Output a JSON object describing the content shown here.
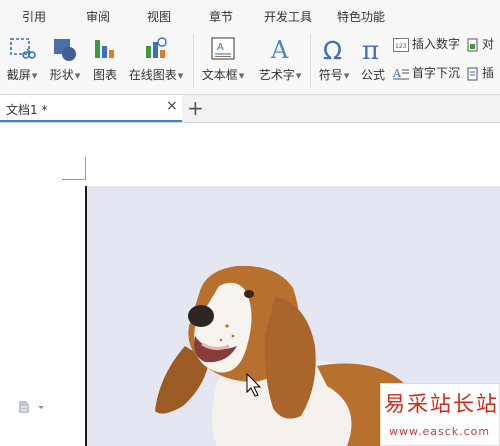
{
  "menu": {
    "tabs": [
      "引用",
      "审阅",
      "视图",
      "章节",
      "开发工具",
      "特色功能"
    ]
  },
  "ribbon": {
    "screenshot": "截屏",
    "shape": "形状",
    "chart": "图表",
    "online_chart": "在线图表",
    "textbox": "文本框",
    "art_text": "艺术字",
    "symbol": "符号",
    "formula": "公式",
    "insert_number": "插入数字",
    "insert_number_icon_text": "123",
    "drop_cap": "首字下沉",
    "object_partial": "对",
    "insert_partial": "插"
  },
  "document_tab": {
    "title": "文档1 *",
    "close": "×",
    "new_tab": "+"
  },
  "watermark": {
    "title": "易采站长站",
    "url": "www.easck.com"
  },
  "colors": {
    "accent": "#3d83d6",
    "photo_background": "#e4e7f1",
    "watermark_red": "#d02a1a"
  }
}
